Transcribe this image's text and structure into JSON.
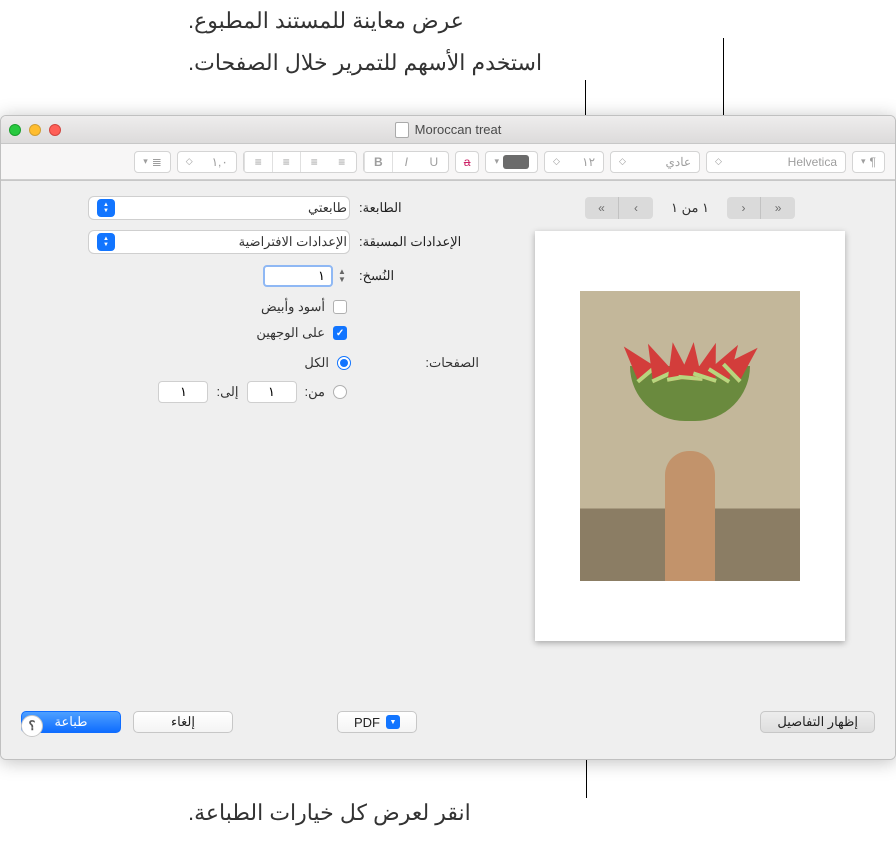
{
  "callouts": {
    "preview": "عرض معاينة للمستند المطبوع.",
    "arrows": "استخدم الأسهم للتمرير خلال الصفحات.",
    "details": "انقر لعرض كل خيارات الطباعة."
  },
  "window": {
    "title": "Moroccan treat"
  },
  "toolbar": {
    "font": "Helvetica",
    "style": "عادي",
    "size": "١٢",
    "line_spacing": "١,٠"
  },
  "pager": {
    "label": "١ من ١"
  },
  "form": {
    "printer_label": "الطابعة:",
    "printer_value": "طابعتي",
    "presets_label": "الإعدادات المسبقة:",
    "presets_value": "الإعدادات الافتراضية",
    "copies_label": "النُسخ:",
    "copies_value": "١",
    "bw_label": "أسود وأبيض",
    "twosided_label": "على الوجهين",
    "pages_label": "الصفحات:",
    "all_label": "الكل",
    "from_label": "من:",
    "from_value": "١",
    "to_label": "إلى:",
    "to_value": "١"
  },
  "buttons": {
    "print": "طباعة",
    "cancel": "إلغاء",
    "pdf": "PDF",
    "details": "إظهار التفاصيل",
    "help": "؟"
  }
}
